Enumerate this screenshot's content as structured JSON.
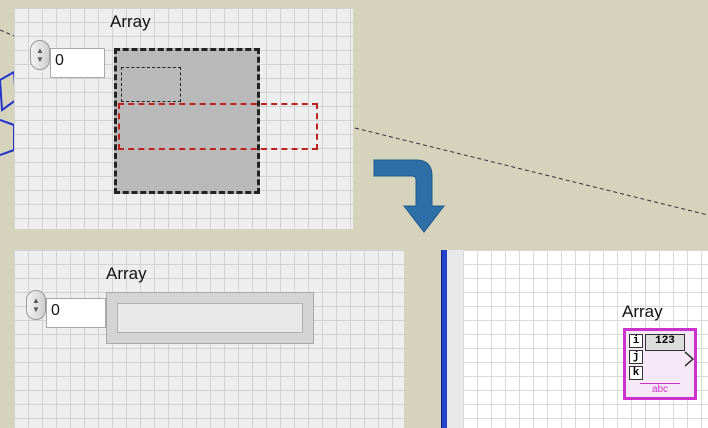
{
  "top_panel": {
    "array_label": "Array",
    "index_value": "0"
  },
  "bottom_left_panel": {
    "array_label": "Array",
    "index_value": "0"
  },
  "block_diagram": {
    "array_label": "Array",
    "terminal_type": "123",
    "terminal_index_letters": [
      "i",
      "j",
      "k"
    ],
    "terminal_element_type": "abc"
  },
  "colors": {
    "background": "#d6d3bd",
    "arrow": "#2e6fa8",
    "terminal_border": "#cc33cc",
    "separator": "#2244cc"
  },
  "icons": [
    "spinner-up-down-icon",
    "curved-down-arrow-icon",
    "array-terminal-icon"
  ]
}
